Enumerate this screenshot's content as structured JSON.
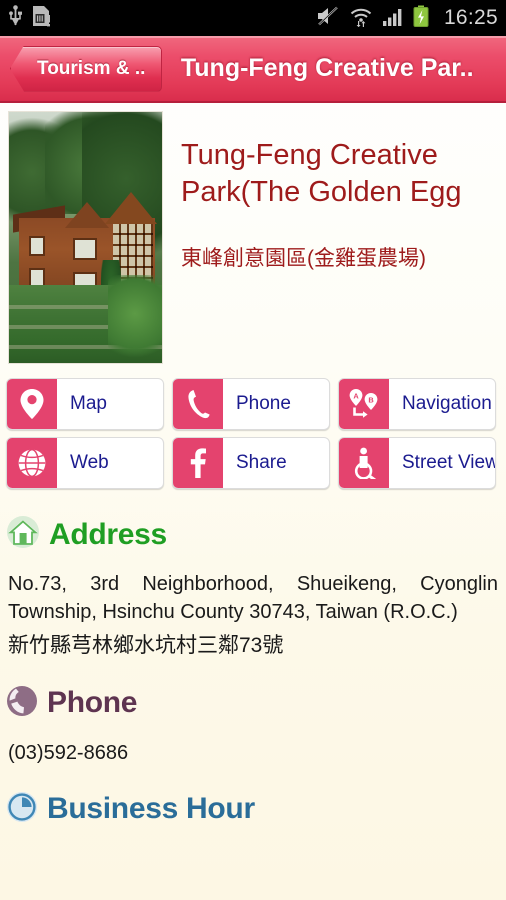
{
  "statusbar": {
    "time": "16:25",
    "icons": [
      "usb-icon",
      "sdcard-warning-icon",
      "mute-icon",
      "wifi-icon",
      "signal-icon",
      "battery-charging-icon"
    ]
  },
  "header": {
    "back_label": "Tourism & ..",
    "title": "Tung-Feng Creative Par.."
  },
  "hero": {
    "photo_alt": "wooden-lodge-photo",
    "title_en": "Tung-Feng Creative Park(The Golden Egg",
    "title_zh": "東峰創意園區(金雞蛋農場)"
  },
  "actions": [
    {
      "label": "Map",
      "icon": "map-pin-icon"
    },
    {
      "label": "Phone",
      "icon": "phone-handset-icon"
    },
    {
      "label": "Navigation",
      "icon": "navigation-ab-icon"
    },
    {
      "label": "Web",
      "icon": "globe-icon"
    },
    {
      "label": "Share",
      "icon": "facebook-icon"
    },
    {
      "label": "Street View",
      "icon": "pegman-icon"
    }
  ],
  "sections": {
    "address": {
      "heading": "Address",
      "icon": "home-icon",
      "text_en": "No.73, 3rd Neighborhood, Shueikeng, Cyonglin Township, Hsinchu County 30743, Taiwan (R.O.C.)",
      "text_zh": "新竹縣芎林鄉水坑村三鄰73號"
    },
    "phone": {
      "heading": "Phone",
      "icon": "phone-circle-icon",
      "number": "(03)592-8686"
    },
    "business_hour": {
      "heading": "Business Hour",
      "icon": "clock-icon"
    }
  },
  "colors": {
    "header_pink": "#e33a57",
    "button_pink": "#e4436e",
    "title_red": "#9e1b1b",
    "label_blue": "#1b1b8f",
    "address_green": "#1f9e23",
    "phone_purple": "#5e3450",
    "hour_blue": "#2a6d99",
    "battery_green": "#8ec63f"
  }
}
